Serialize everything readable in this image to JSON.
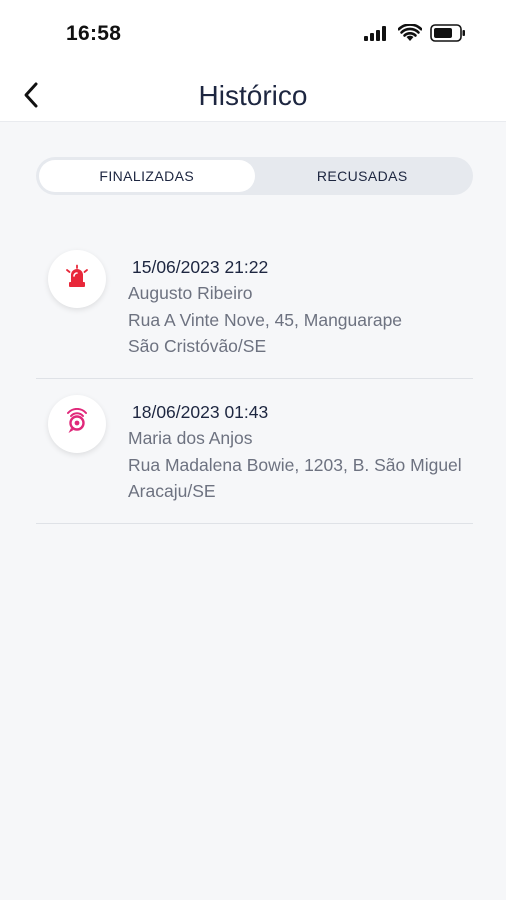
{
  "status_bar": {
    "time": "16:58"
  },
  "header": {
    "title": "Histórico"
  },
  "tabs": [
    {
      "label": "FINALIZADAS",
      "active": true
    },
    {
      "label": "RECUSADAS",
      "active": false
    }
  ],
  "colors": {
    "accent_red": "#e8283a",
    "accent_pink": "#e0287a",
    "title": "#1d2640",
    "secondary_text": "#6d7280"
  },
  "items": [
    {
      "icon": "alarm-siren-icon",
      "datetime": "15/06/2023 21:22",
      "name": "Augusto Ribeiro",
      "address": "Rua A Vinte Nove, 45, Manguarape",
      "city": "São Cristóvão/SE"
    },
    {
      "icon": "location-target-icon",
      "datetime": "18/06/2023 01:43",
      "name": "Maria dos Anjos",
      "address": "Rua Madalena Bowie, 1203, B. São Miguel",
      "city": "Aracaju/SE"
    }
  ]
}
